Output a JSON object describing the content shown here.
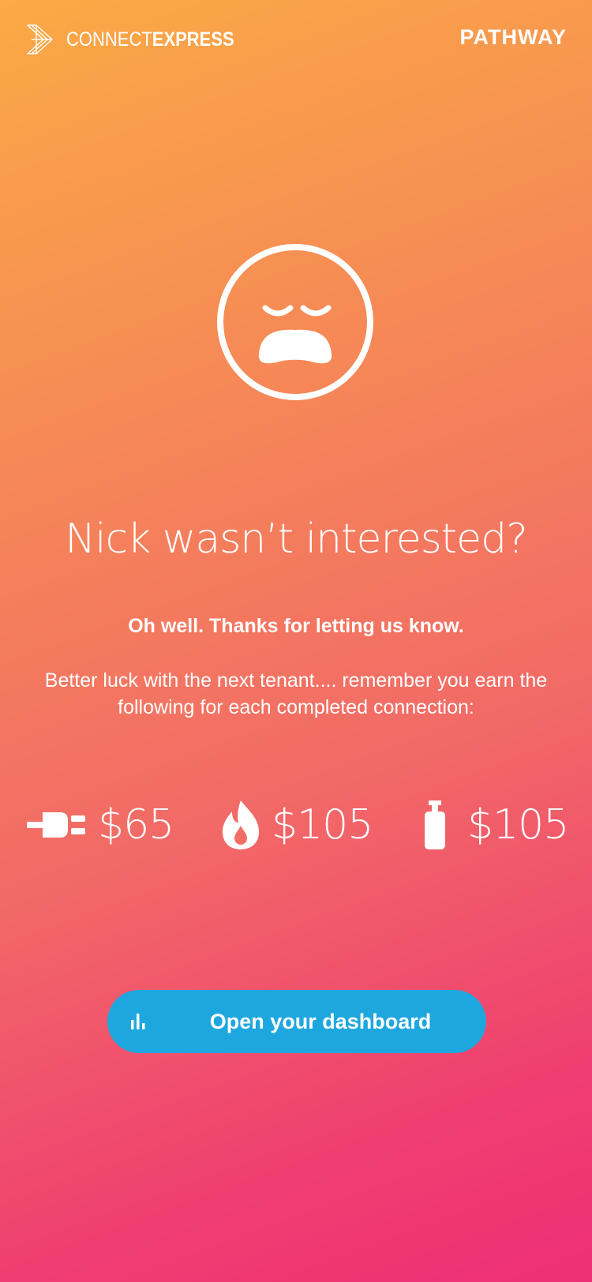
{
  "header": {
    "brand_connect": "CONNECT",
    "brand_express": "EXPRESS",
    "brand_icon": "chevron-logo-icon",
    "partner_logo": "PATHWAY"
  },
  "hero": {
    "icon": "sad-face-icon"
  },
  "content": {
    "title": "Nick wasn’t interested?",
    "subtitle": "Oh well. Thanks for letting us know.",
    "body": "Better luck with the next tenant.... remember you earn the following for each completed connection:"
  },
  "rewards": [
    {
      "icon": "electric-plug-icon",
      "value": "$65"
    },
    {
      "icon": "gas-flame-icon",
      "value": "$105"
    },
    {
      "icon": "gas-bottle-icon",
      "value": "$105"
    }
  ],
  "cta": {
    "icon": "bar-chart-icon",
    "label": "Open your dashboard",
    "color": "#1ea7df"
  },
  "colors": {
    "gradient_top": "#fbaa45",
    "gradient_bottom": "#ee2f75",
    "text": "#ffffff"
  }
}
